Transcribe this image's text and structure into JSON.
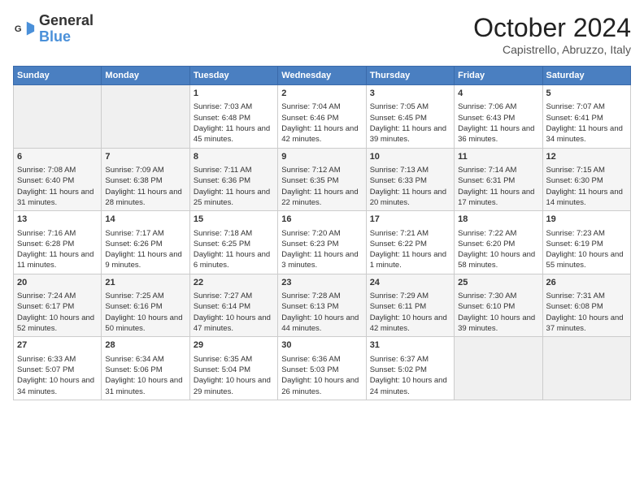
{
  "header": {
    "logo_line1": "General",
    "logo_line2": "Blue",
    "title": "October 2024",
    "location": "Capistrello, Abruzzo, Italy"
  },
  "days_of_week": [
    "Sunday",
    "Monday",
    "Tuesday",
    "Wednesday",
    "Thursday",
    "Friday",
    "Saturday"
  ],
  "weeks": [
    [
      {
        "day": "",
        "info": ""
      },
      {
        "day": "",
        "info": ""
      },
      {
        "day": "1",
        "info": "Sunrise: 7:03 AM\nSunset: 6:48 PM\nDaylight: 11 hours and 45 minutes."
      },
      {
        "day": "2",
        "info": "Sunrise: 7:04 AM\nSunset: 6:46 PM\nDaylight: 11 hours and 42 minutes."
      },
      {
        "day": "3",
        "info": "Sunrise: 7:05 AM\nSunset: 6:45 PM\nDaylight: 11 hours and 39 minutes."
      },
      {
        "day": "4",
        "info": "Sunrise: 7:06 AM\nSunset: 6:43 PM\nDaylight: 11 hours and 36 minutes."
      },
      {
        "day": "5",
        "info": "Sunrise: 7:07 AM\nSunset: 6:41 PM\nDaylight: 11 hours and 34 minutes."
      }
    ],
    [
      {
        "day": "6",
        "info": "Sunrise: 7:08 AM\nSunset: 6:40 PM\nDaylight: 11 hours and 31 minutes."
      },
      {
        "day": "7",
        "info": "Sunrise: 7:09 AM\nSunset: 6:38 PM\nDaylight: 11 hours and 28 minutes."
      },
      {
        "day": "8",
        "info": "Sunrise: 7:11 AM\nSunset: 6:36 PM\nDaylight: 11 hours and 25 minutes."
      },
      {
        "day": "9",
        "info": "Sunrise: 7:12 AM\nSunset: 6:35 PM\nDaylight: 11 hours and 22 minutes."
      },
      {
        "day": "10",
        "info": "Sunrise: 7:13 AM\nSunset: 6:33 PM\nDaylight: 11 hours and 20 minutes."
      },
      {
        "day": "11",
        "info": "Sunrise: 7:14 AM\nSunset: 6:31 PM\nDaylight: 11 hours and 17 minutes."
      },
      {
        "day": "12",
        "info": "Sunrise: 7:15 AM\nSunset: 6:30 PM\nDaylight: 11 hours and 14 minutes."
      }
    ],
    [
      {
        "day": "13",
        "info": "Sunrise: 7:16 AM\nSunset: 6:28 PM\nDaylight: 11 hours and 11 minutes."
      },
      {
        "day": "14",
        "info": "Sunrise: 7:17 AM\nSunset: 6:26 PM\nDaylight: 11 hours and 9 minutes."
      },
      {
        "day": "15",
        "info": "Sunrise: 7:18 AM\nSunset: 6:25 PM\nDaylight: 11 hours and 6 minutes."
      },
      {
        "day": "16",
        "info": "Sunrise: 7:20 AM\nSunset: 6:23 PM\nDaylight: 11 hours and 3 minutes."
      },
      {
        "day": "17",
        "info": "Sunrise: 7:21 AM\nSunset: 6:22 PM\nDaylight: 11 hours and 1 minute."
      },
      {
        "day": "18",
        "info": "Sunrise: 7:22 AM\nSunset: 6:20 PM\nDaylight: 10 hours and 58 minutes."
      },
      {
        "day": "19",
        "info": "Sunrise: 7:23 AM\nSunset: 6:19 PM\nDaylight: 10 hours and 55 minutes."
      }
    ],
    [
      {
        "day": "20",
        "info": "Sunrise: 7:24 AM\nSunset: 6:17 PM\nDaylight: 10 hours and 52 minutes."
      },
      {
        "day": "21",
        "info": "Sunrise: 7:25 AM\nSunset: 6:16 PM\nDaylight: 10 hours and 50 minutes."
      },
      {
        "day": "22",
        "info": "Sunrise: 7:27 AM\nSunset: 6:14 PM\nDaylight: 10 hours and 47 minutes."
      },
      {
        "day": "23",
        "info": "Sunrise: 7:28 AM\nSunset: 6:13 PM\nDaylight: 10 hours and 44 minutes."
      },
      {
        "day": "24",
        "info": "Sunrise: 7:29 AM\nSunset: 6:11 PM\nDaylight: 10 hours and 42 minutes."
      },
      {
        "day": "25",
        "info": "Sunrise: 7:30 AM\nSunset: 6:10 PM\nDaylight: 10 hours and 39 minutes."
      },
      {
        "day": "26",
        "info": "Sunrise: 7:31 AM\nSunset: 6:08 PM\nDaylight: 10 hours and 37 minutes."
      }
    ],
    [
      {
        "day": "27",
        "info": "Sunrise: 6:33 AM\nSunset: 5:07 PM\nDaylight: 10 hours and 34 minutes."
      },
      {
        "day": "28",
        "info": "Sunrise: 6:34 AM\nSunset: 5:06 PM\nDaylight: 10 hours and 31 minutes."
      },
      {
        "day": "29",
        "info": "Sunrise: 6:35 AM\nSunset: 5:04 PM\nDaylight: 10 hours and 29 minutes."
      },
      {
        "day": "30",
        "info": "Sunrise: 6:36 AM\nSunset: 5:03 PM\nDaylight: 10 hours and 26 minutes."
      },
      {
        "day": "31",
        "info": "Sunrise: 6:37 AM\nSunset: 5:02 PM\nDaylight: 10 hours and 24 minutes."
      },
      {
        "day": "",
        "info": ""
      },
      {
        "day": "",
        "info": ""
      }
    ]
  ]
}
